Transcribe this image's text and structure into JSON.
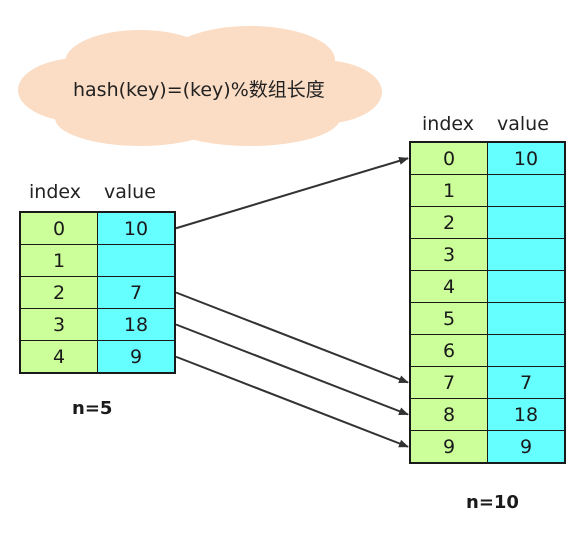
{
  "formula": "hash(key)=(key)%数组长度",
  "headers": {
    "index": "index",
    "value": "value"
  },
  "left_table": {
    "n_label": "n=5",
    "rows": [
      {
        "index": "0",
        "value": "10"
      },
      {
        "index": "1",
        "value": ""
      },
      {
        "index": "2",
        "value": "7"
      },
      {
        "index": "3",
        "value": "18"
      },
      {
        "index": "4",
        "value": "9"
      }
    ]
  },
  "right_table": {
    "n_label": "n=10",
    "rows": [
      {
        "index": "0",
        "value": "10"
      },
      {
        "index": "1",
        "value": ""
      },
      {
        "index": "2",
        "value": ""
      },
      {
        "index": "3",
        "value": ""
      },
      {
        "index": "4",
        "value": ""
      },
      {
        "index": "5",
        "value": ""
      },
      {
        "index": "6",
        "value": ""
      },
      {
        "index": "7",
        "value": "7"
      },
      {
        "index": "8",
        "value": "18"
      },
      {
        "index": "9",
        "value": "9"
      }
    ]
  },
  "arrows": [
    {
      "from": "left.0",
      "to": "right.0"
    },
    {
      "from": "left.2",
      "to": "right.7"
    },
    {
      "from": "left.3",
      "to": "right.8"
    },
    {
      "from": "left.4",
      "to": "right.9"
    }
  ],
  "colors": {
    "index_cell": "#ccff99",
    "value_cell": "#66ffff",
    "cloud": "#fbdcc4",
    "arrow": "#333333"
  }
}
